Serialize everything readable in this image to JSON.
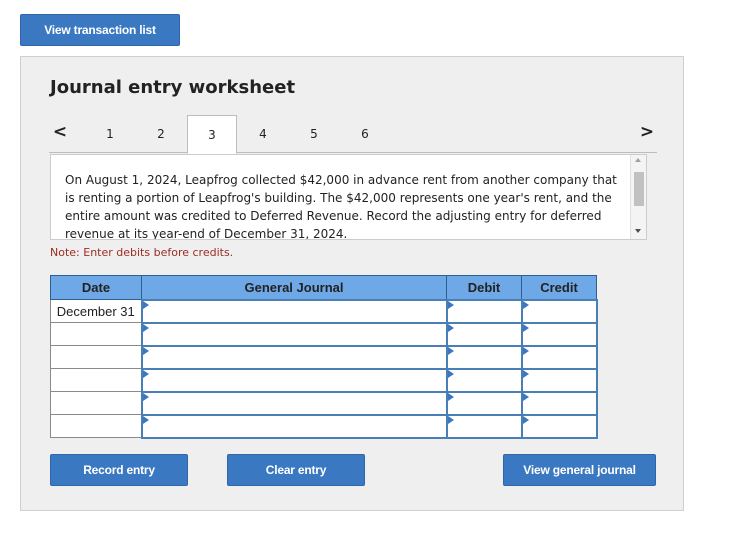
{
  "header": {
    "view_transaction_list": "View transaction list"
  },
  "worksheet": {
    "title": "Journal entry worksheet",
    "nav": {
      "prev": "<",
      "next": ">"
    },
    "tabs": [
      {
        "label": "1",
        "active": false
      },
      {
        "label": "2",
        "active": false
      },
      {
        "label": "3",
        "active": true
      },
      {
        "label": "4",
        "active": false
      },
      {
        "label": "5",
        "active": false
      },
      {
        "label": "6",
        "active": false
      }
    ],
    "problem_text": "On August 1, 2024, Leapfrog collected $42,000 in advance rent from another company that is renting a portion of Leapfrog's building. The $42,000 represents one year's rent, and the entire amount was credited to Deferred Revenue. Record the adjusting entry for deferred revenue at its year-end of December 31, 2024.",
    "note": "Note: Enter debits before credits.",
    "table": {
      "headers": {
        "date": "Date",
        "general_journal": "General Journal",
        "debit": "Debit",
        "credit": "Credit"
      },
      "rows": [
        {
          "date": "December 31",
          "account": "",
          "debit": "",
          "credit": ""
        },
        {
          "date": "",
          "account": "",
          "debit": "",
          "credit": ""
        },
        {
          "date": "",
          "account": "",
          "debit": "",
          "credit": ""
        },
        {
          "date": "",
          "account": "",
          "debit": "",
          "credit": ""
        },
        {
          "date": "",
          "account": "",
          "debit": "",
          "credit": ""
        },
        {
          "date": "",
          "account": "",
          "debit": "",
          "credit": ""
        }
      ]
    },
    "buttons": {
      "record_entry": "Record entry",
      "clear_entry": "Clear entry",
      "view_general_journal": "View general journal"
    }
  },
  "colors": {
    "button_blue": "#3b78c2",
    "header_blue": "#6fa8e6",
    "note_red": "#9b2c22",
    "panel_gray": "#efefef"
  }
}
